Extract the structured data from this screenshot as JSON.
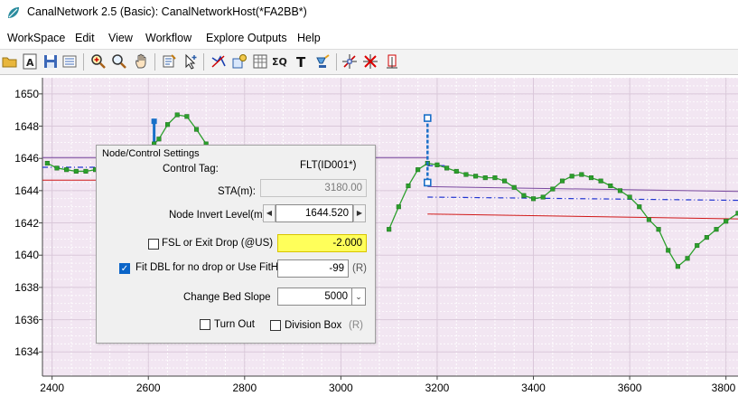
{
  "window": {
    "title": "CanalNetwork 2.5  (Basic): CanalNetworkHost(*FA2BB*)"
  },
  "menu": [
    "WorkSpace",
    "Edit",
    "View",
    "Workflow",
    "Explore Outputs",
    "Help"
  ],
  "toolbar": {
    "buttons": [
      "open-folder-icon",
      "text-a-icon",
      "save-icon",
      "list-icon",
      "zoom-in-icon",
      "zoom-icon",
      "hand-icon",
      "edit-node-icon",
      "pointer-add-icon",
      "line-select-icon",
      "node-settings-icon",
      "table-icon",
      "sigma-q-icon",
      "text-t-icon",
      "paint-icon",
      "add-point-icon",
      "delete-point-icon",
      "insert-point-icon"
    ]
  },
  "chart_data": {
    "type": "line",
    "y_ticks": [
      "1650",
      "1648",
      "1646",
      "1644",
      "1642",
      "1640",
      "1638",
      "1636",
      "1634"
    ],
    "x_ticks": [
      "2400",
      "2600",
      "2800",
      "3000",
      "3200",
      "3400",
      "3600",
      "3800"
    ],
    "xlim": [
      2380,
      3825
    ],
    "ylim": [
      1632.5,
      1651
    ],
    "grid": true,
    "series": [
      {
        "color": "#2ca02c",
        "marker": "square",
        "x": [
          2390,
          2410,
          2430,
          2450,
          2470,
          2490,
          2510,
          2530
        ],
        "y": [
          1645.7,
          1645.4,
          1645.3,
          1645.2,
          1645.2,
          1645.3,
          1645.4,
          1645.5
        ]
      },
      {
        "color": "#2ca02c",
        "marker": "square",
        "x": [
          2612,
          2622,
          2640,
          2660,
          2680,
          2700,
          2720
        ],
        "y": [
          1646.9,
          1647.2,
          1648.1,
          1648.7,
          1648.6,
          1647.8,
          1646.9
        ]
      },
      {
        "color": "#2ca02c",
        "marker": "square",
        "x": [
          3100,
          3120,
          3140,
          3160,
          3180,
          3200,
          3220,
          3240,
          3260,
          3280,
          3300,
          3320,
          3340,
          3360,
          3380,
          3400,
          3420,
          3440,
          3460,
          3480,
          3500,
          3520,
          3540,
          3560,
          3580,
          3600,
          3620,
          3640,
          3660,
          3680,
          3700,
          3720,
          3740,
          3760,
          3780,
          3800,
          3825
        ],
        "y": [
          1641.6,
          1643.0,
          1644.3,
          1645.3,
          1645.7,
          1645.6,
          1645.4,
          1645.2,
          1645.0,
          1644.9,
          1644.8,
          1644.8,
          1644.6,
          1644.2,
          1643.7,
          1643.5,
          1643.6,
          1644.1,
          1644.6,
          1644.9,
          1645.0,
          1644.8,
          1644.6,
          1644.3,
          1644.0,
          1643.6,
          1643.0,
          1642.2,
          1641.6,
          1640.3,
          1639.3,
          1639.8,
          1640.6,
          1641.1,
          1641.6,
          1642.1,
          1642.6
        ]
      }
    ],
    "invert_marker": {
      "station": 3180,
      "top": 1648.5,
      "bottom": 1644.5
    }
  },
  "dialog": {
    "title": "Node/Control Settings",
    "control_tag_label": "Control Tag:",
    "control_tag_value": "FLT(ID001*)",
    "sta_label": "STA(m):",
    "sta_value": "3180.00",
    "invert_label": "Node Invert Level(m):",
    "invert_value": "1644.520",
    "fsl_label": "FSL or Exit Drop (@US)",
    "fsl_value": "-2.000",
    "fit_label": "Fit DBL for no drop or Use FitHt:",
    "fit_value": "-99",
    "fit_unit": "(R)",
    "bed_slope_label": "Change Bed Slope",
    "bed_slope_value": "5000",
    "turn_out_label": "Turn Out",
    "division_box_label": "Division Box",
    "division_box_unit": "(R)",
    "fsl_checked": false,
    "fit_checked": true,
    "turn_out_checked": false,
    "division_box_checked": false
  }
}
